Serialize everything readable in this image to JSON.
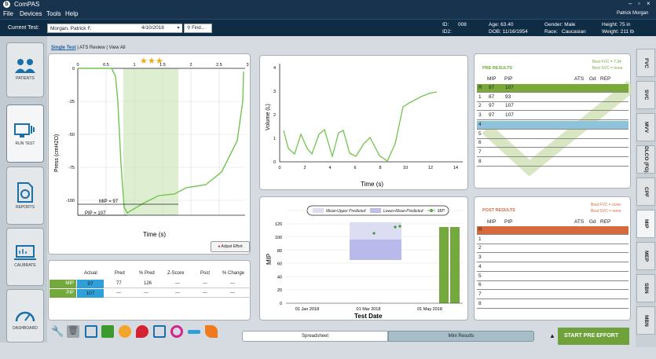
{
  "app": {
    "title": "ComPAS"
  },
  "menu": {
    "file": "File",
    "devices": "Devices",
    "tools": "Tools",
    "help": "Help",
    "user": "Patrick Morgan"
  },
  "test": {
    "label": "Current Test:",
    "patient": "Morgan, Patrick F.",
    "date": "4/10/2018",
    "find": "Find...",
    "id_label": "ID:",
    "id_value": "008",
    "id2_label": "ID2:",
    "age": "Age: 63.40",
    "dob": "DOB: 11/16/1954",
    "gender": "Gender: Male",
    "race": "Race:",
    "race_value": "Caucasian",
    "height": "Height: 75 in",
    "weight": "Weight: 211 lb"
  },
  "sidebar": {
    "patients": "PATIENTS",
    "run_test": "RUN TEST",
    "reports": "REPORTS",
    "calibrate": "CALIBRATE",
    "dashboard": "DASHBOARD"
  },
  "view_tabs": {
    "single": "Single Test",
    "ats": "ATS Review",
    "all": "View All"
  },
  "pressure_chart": {
    "ylabel": "Press (cmH2O)",
    "xlabel": "Time (s)",
    "xticks": [
      "0",
      "0.5",
      "1",
      "1.5",
      "2",
      "2.5",
      "3"
    ],
    "yticks": [
      "0",
      "-25",
      "-50",
      "-75",
      "-100"
    ],
    "mip_label": "MIP = 97",
    "pip_label": "PIP = 107",
    "adjust": "Adjust Effort"
  },
  "volume_chart": {
    "ylabel": "Volume (L)",
    "xlabel": "Time (s)",
    "xticks": [
      "0",
      "2",
      "4",
      "6",
      "8",
      "10",
      "12",
      "14"
    ],
    "yticks": [
      "0",
      "1",
      "2",
      "3",
      "4"
    ]
  },
  "trend_chart": {
    "ylabel": "MIP",
    "xlabel": "Test Date",
    "yticks": [
      "0",
      "20",
      "40",
      "60",
      "80",
      "100",
      "120"
    ],
    "xticks": [
      "01 Jan 2018",
      "01 Mar 2018",
      "01 May 2018"
    ],
    "legend_upper": "Mean-Upper Predicted",
    "legend_lower": "Lower-Mean-Predicted",
    "legend_mip": "MIP"
  },
  "results_table": {
    "headers": [
      "Actual",
      "Pred",
      "% Pred",
      "Z-Score",
      "Post",
      "% Change"
    ],
    "rows": [
      {
        "label": "MIP",
        "actual": "97",
        "pred": "77",
        "pct": "126",
        "z": "---",
        "post": "---",
        "chg": "---"
      },
      {
        "label": "PIP",
        "actual": "107",
        "pred": "---",
        "pct": "---",
        "z": "---",
        "post": "---",
        "chg": "---"
      }
    ]
  },
  "pre_results": {
    "title": "PRE RESULTS",
    "best_fvc": "Best FVC = 7.34",
    "best_svc": "Best SVC = none",
    "h_mip": "MIP",
    "h_pip": "PIP",
    "h_ats": "ATS",
    "h_gd": "Gd",
    "h_rep": "REP",
    "rows": [
      {
        "n": "R",
        "mip": "97",
        "pip": "107"
      },
      {
        "n": "1",
        "mip": "87",
        "pip": "93"
      },
      {
        "n": "2",
        "mip": "97",
        "pip": "107"
      },
      {
        "n": "3",
        "mip": "97",
        "pip": "107"
      },
      {
        "n": "4"
      },
      {
        "n": "5"
      },
      {
        "n": "6"
      },
      {
        "n": "7"
      },
      {
        "n": "8"
      }
    ]
  },
  "post_results": {
    "title": "POST RESULTS",
    "best_fvc": "Best FVC = none",
    "best_svc": "Best SVC = none",
    "h_mip": "MIP",
    "h_pip": "PIP",
    "h_ats": "ATS",
    "h_gd": "Gd",
    "h_rep": "REP",
    "rows": [
      {
        "n": "R"
      },
      {
        "n": "1"
      },
      {
        "n": "2"
      },
      {
        "n": "3"
      },
      {
        "n": "4"
      },
      {
        "n": "5"
      },
      {
        "n": "6"
      },
      {
        "n": "7"
      },
      {
        "n": "8"
      }
    ]
  },
  "right_tabs": [
    "FVC",
    "SVC",
    "MVV",
    "DLCO (FG)",
    "CPF",
    "MIP",
    "MEP",
    "SBN",
    "MBN"
  ],
  "bottom": {
    "spreadsheet": "Spreadsheet",
    "mini_results": "Mini Results",
    "start": "START PRE EFFORT"
  },
  "colors": {
    "green": "#7aa93a",
    "blue": "#2e9fd9",
    "orange": "#d66a3d",
    "selected": "#8ec3d9"
  }
}
